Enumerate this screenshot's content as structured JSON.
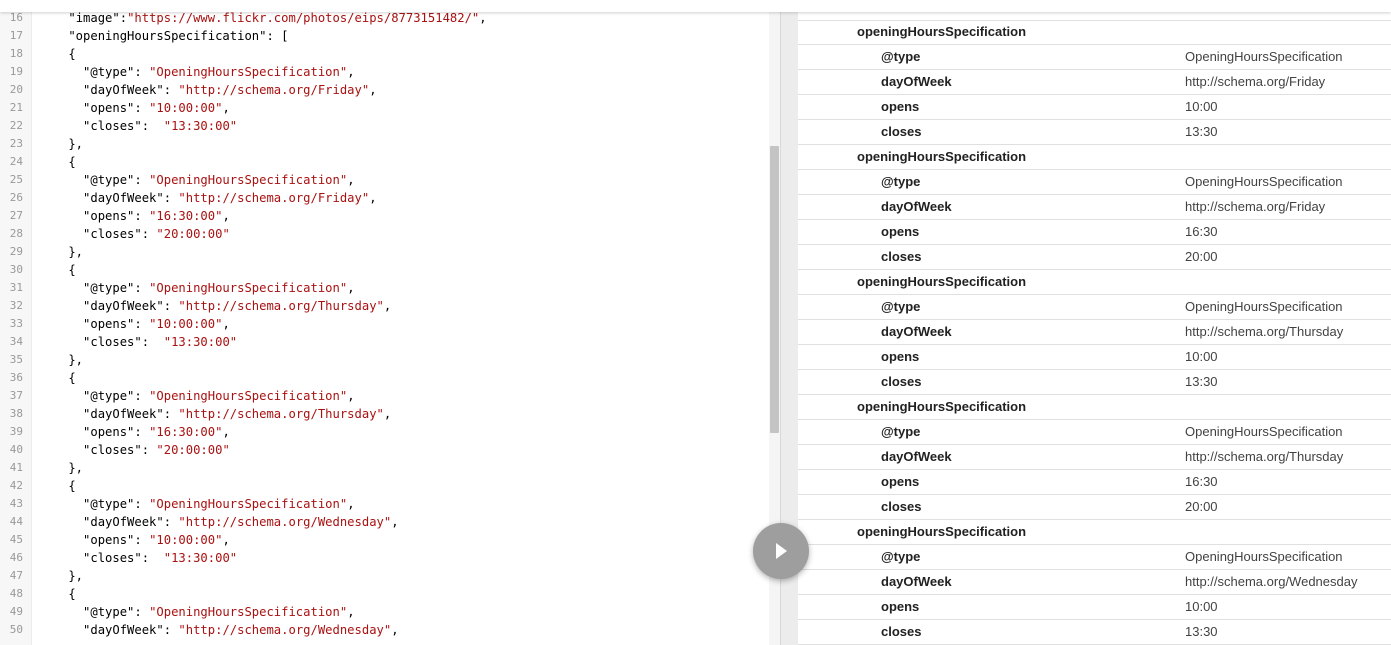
{
  "editor": {
    "lines": [
      {
        "n": "16",
        "parts": [
          [
            "p",
            "    \""
          ],
          [
            "p",
            "image"
          ],
          [
            "p",
            "\":"
          ],
          [
            "s",
            "\"https://www.flickr.com/photos/eips/8773151482/\""
          ],
          [
            "p",
            ","
          ]
        ]
      },
      {
        "n": "17",
        "parts": [
          [
            "p",
            "    \"openingHoursSpecification\": ["
          ]
        ]
      },
      {
        "n": "18",
        "parts": [
          [
            "p",
            "    {"
          ]
        ]
      },
      {
        "n": "19",
        "parts": [
          [
            "p",
            "      \"@type\": "
          ],
          [
            "s",
            "\"OpeningHoursSpecification\""
          ],
          [
            "p",
            ","
          ]
        ]
      },
      {
        "n": "20",
        "parts": [
          [
            "p",
            "      \"dayOfWeek\": "
          ],
          [
            "s",
            "\"http://schema.org/Friday\""
          ],
          [
            "p",
            ","
          ]
        ]
      },
      {
        "n": "21",
        "parts": [
          [
            "p",
            "      \"opens\": "
          ],
          [
            "s",
            "\"10:00:00\""
          ],
          [
            "p",
            ","
          ]
        ]
      },
      {
        "n": "22",
        "parts": [
          [
            "p",
            "      \"closes\":  "
          ],
          [
            "s",
            "\"13:30:00\""
          ]
        ]
      },
      {
        "n": "23",
        "parts": [
          [
            "p",
            "    },"
          ]
        ]
      },
      {
        "n": "24",
        "parts": [
          [
            "p",
            "    {"
          ]
        ]
      },
      {
        "n": "25",
        "parts": [
          [
            "p",
            "      \"@type\": "
          ],
          [
            "s",
            "\"OpeningHoursSpecification\""
          ],
          [
            "p",
            ","
          ]
        ]
      },
      {
        "n": "26",
        "parts": [
          [
            "p",
            "      \"dayOfWeek\": "
          ],
          [
            "s",
            "\"http://schema.org/Friday\""
          ],
          [
            "p",
            ","
          ]
        ]
      },
      {
        "n": "27",
        "parts": [
          [
            "p",
            "      \"opens\": "
          ],
          [
            "s",
            "\"16:30:00\""
          ],
          [
            "p",
            ","
          ]
        ]
      },
      {
        "n": "28",
        "parts": [
          [
            "p",
            "      \"closes\": "
          ],
          [
            "s",
            "\"20:00:00\""
          ]
        ]
      },
      {
        "n": "29",
        "parts": [
          [
            "p",
            "    },"
          ]
        ]
      },
      {
        "n": "30",
        "parts": [
          [
            "p",
            "    {"
          ]
        ]
      },
      {
        "n": "31",
        "parts": [
          [
            "p",
            "      \"@type\": "
          ],
          [
            "s",
            "\"OpeningHoursSpecification\""
          ],
          [
            "p",
            ","
          ]
        ]
      },
      {
        "n": "32",
        "parts": [
          [
            "p",
            "      \"dayOfWeek\": "
          ],
          [
            "s",
            "\"http://schema.org/Thursday\""
          ],
          [
            "p",
            ","
          ]
        ]
      },
      {
        "n": "33",
        "parts": [
          [
            "p",
            "      \"opens\": "
          ],
          [
            "s",
            "\"10:00:00\""
          ],
          [
            "p",
            ","
          ]
        ]
      },
      {
        "n": "34",
        "parts": [
          [
            "p",
            "      \"closes\":  "
          ],
          [
            "s",
            "\"13:30:00\""
          ]
        ]
      },
      {
        "n": "35",
        "parts": [
          [
            "p",
            "    },"
          ]
        ]
      },
      {
        "n": "36",
        "parts": [
          [
            "p",
            "    {"
          ]
        ]
      },
      {
        "n": "37",
        "parts": [
          [
            "p",
            "      \"@type\": "
          ],
          [
            "s",
            "\"OpeningHoursSpecification\""
          ],
          [
            "p",
            ","
          ]
        ]
      },
      {
        "n": "38",
        "parts": [
          [
            "p",
            "      \"dayOfWeek\": "
          ],
          [
            "s",
            "\"http://schema.org/Thursday\""
          ],
          [
            "p",
            ","
          ]
        ]
      },
      {
        "n": "39",
        "parts": [
          [
            "p",
            "      \"opens\": "
          ],
          [
            "s",
            "\"16:30:00\""
          ],
          [
            "p",
            ","
          ]
        ]
      },
      {
        "n": "40",
        "parts": [
          [
            "p",
            "      \"closes\": "
          ],
          [
            "s",
            "\"20:00:00\""
          ]
        ]
      },
      {
        "n": "41",
        "parts": [
          [
            "p",
            "    },"
          ]
        ]
      },
      {
        "n": "42",
        "parts": [
          [
            "p",
            "    {"
          ]
        ]
      },
      {
        "n": "43",
        "parts": [
          [
            "p",
            "      \"@type\": "
          ],
          [
            "s",
            "\"OpeningHoursSpecification\""
          ],
          [
            "p",
            ","
          ]
        ]
      },
      {
        "n": "44",
        "parts": [
          [
            "p",
            "      \"dayOfWeek\": "
          ],
          [
            "s",
            "\"http://schema.org/Wednesday\""
          ],
          [
            "p",
            ","
          ]
        ]
      },
      {
        "n": "45",
        "parts": [
          [
            "p",
            "      \"opens\": "
          ],
          [
            "s",
            "\"10:00:00\""
          ],
          [
            "p",
            ","
          ]
        ]
      },
      {
        "n": "46",
        "parts": [
          [
            "p",
            "      \"closes\":  "
          ],
          [
            "s",
            "\"13:30:00\""
          ]
        ]
      },
      {
        "n": "47",
        "parts": [
          [
            "p",
            "    },"
          ]
        ]
      },
      {
        "n": "48",
        "parts": [
          [
            "p",
            "    {"
          ]
        ]
      },
      {
        "n": "49",
        "parts": [
          [
            "p",
            "      \"@type\": "
          ],
          [
            "s",
            "\"OpeningHoursSpecification\""
          ],
          [
            "p",
            ","
          ]
        ]
      },
      {
        "n": "50",
        "parts": [
          [
            "p",
            "      \"dayOfWeek\": "
          ],
          [
            "s",
            "\"http://schema.org/Wednesday\""
          ],
          [
            "p",
            ","
          ]
        ]
      }
    ]
  },
  "run_button": {
    "icon": "play-icon"
  },
  "results": {
    "groups": [
      {
        "name": "openingHoursSpecification",
        "props": [
          {
            "k": "@type",
            "v": "OpeningHoursSpecification"
          },
          {
            "k": "dayOfWeek",
            "v": "http://schema.org/Friday"
          },
          {
            "k": "opens",
            "v": "10:00"
          },
          {
            "k": "closes",
            "v": "13:30"
          }
        ]
      },
      {
        "name": "openingHoursSpecification",
        "props": [
          {
            "k": "@type",
            "v": "OpeningHoursSpecification"
          },
          {
            "k": "dayOfWeek",
            "v": "http://schema.org/Friday"
          },
          {
            "k": "opens",
            "v": "16:30"
          },
          {
            "k": "closes",
            "v": "20:00"
          }
        ]
      },
      {
        "name": "openingHoursSpecification",
        "props": [
          {
            "k": "@type",
            "v": "OpeningHoursSpecification"
          },
          {
            "k": "dayOfWeek",
            "v": "http://schema.org/Thursday"
          },
          {
            "k": "opens",
            "v": "10:00"
          },
          {
            "k": "closes",
            "v": "13:30"
          }
        ]
      },
      {
        "name": "openingHoursSpecification",
        "props": [
          {
            "k": "@type",
            "v": "OpeningHoursSpecification"
          },
          {
            "k": "dayOfWeek",
            "v": "http://schema.org/Thursday"
          },
          {
            "k": "opens",
            "v": "16:30"
          },
          {
            "k": "closes",
            "v": "20:00"
          }
        ]
      },
      {
        "name": "openingHoursSpecification",
        "props": [
          {
            "k": "@type",
            "v": "OpeningHoursSpecification"
          },
          {
            "k": "dayOfWeek",
            "v": "http://schema.org/Wednesday"
          },
          {
            "k": "opens",
            "v": "10:00"
          },
          {
            "k": "closes",
            "v": "13:30"
          }
        ]
      }
    ]
  }
}
